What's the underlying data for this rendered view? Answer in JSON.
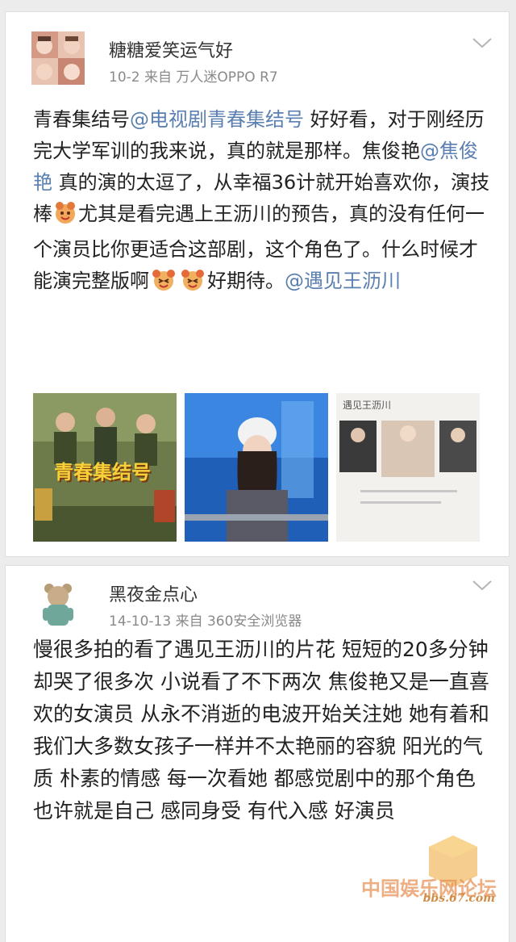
{
  "posts": [
    {
      "username": "糖糖爱笑运气好",
      "date": "10-2",
      "source": "来自 万人迷OPPO R7",
      "text": {
        "p1": "青春集结号",
        "m1": "@电视剧青春集结号",
        "p2": " 好好看，对于刚经历完大学军训的我来说，真的就是那样。焦俊艳",
        "m2": "@焦俊艳",
        "p3": " 真的演的太逗了，从幸福36计就开始喜欢你，演技棒",
        "p4": "尤其是看完遇上王沥川的预告，真的没有任何一个演员比你更适合这部剧，这个角色了。什么时候才能演完整版啊",
        "p5": "好期待。",
        "m3": "@遇见王沥川"
      },
      "images": [
        {
          "caption": "青春集结号"
        },
        {
          "caption": ""
        },
        {
          "caption": "遇见王沥川"
        }
      ]
    },
    {
      "username": "黑夜金点心",
      "date": "14-10-13",
      "source": "来自 360安全浏览器",
      "text": "慢很多拍的看了遇见王沥川的片花 短短的20多分钟却哭了很多次 小说看了不下两次 焦俊艳又是一直喜欢的女演员 从永不消逝的电波开始关注她 她有着和我们大多数女孩子一样并不太艳丽的容貌 阳光的气质 朴素的情感 每一次看她 都感觉剧中的那个角色也许就是自己 感同身受 有代入感 好演员"
    }
  ],
  "watermark": {
    "site": "中国娱乐网论坛",
    "url": "bbs.67.com"
  },
  "colors": {
    "mention": "#5a7fb0",
    "meta": "#8a8a8a",
    "text": "#222222"
  }
}
